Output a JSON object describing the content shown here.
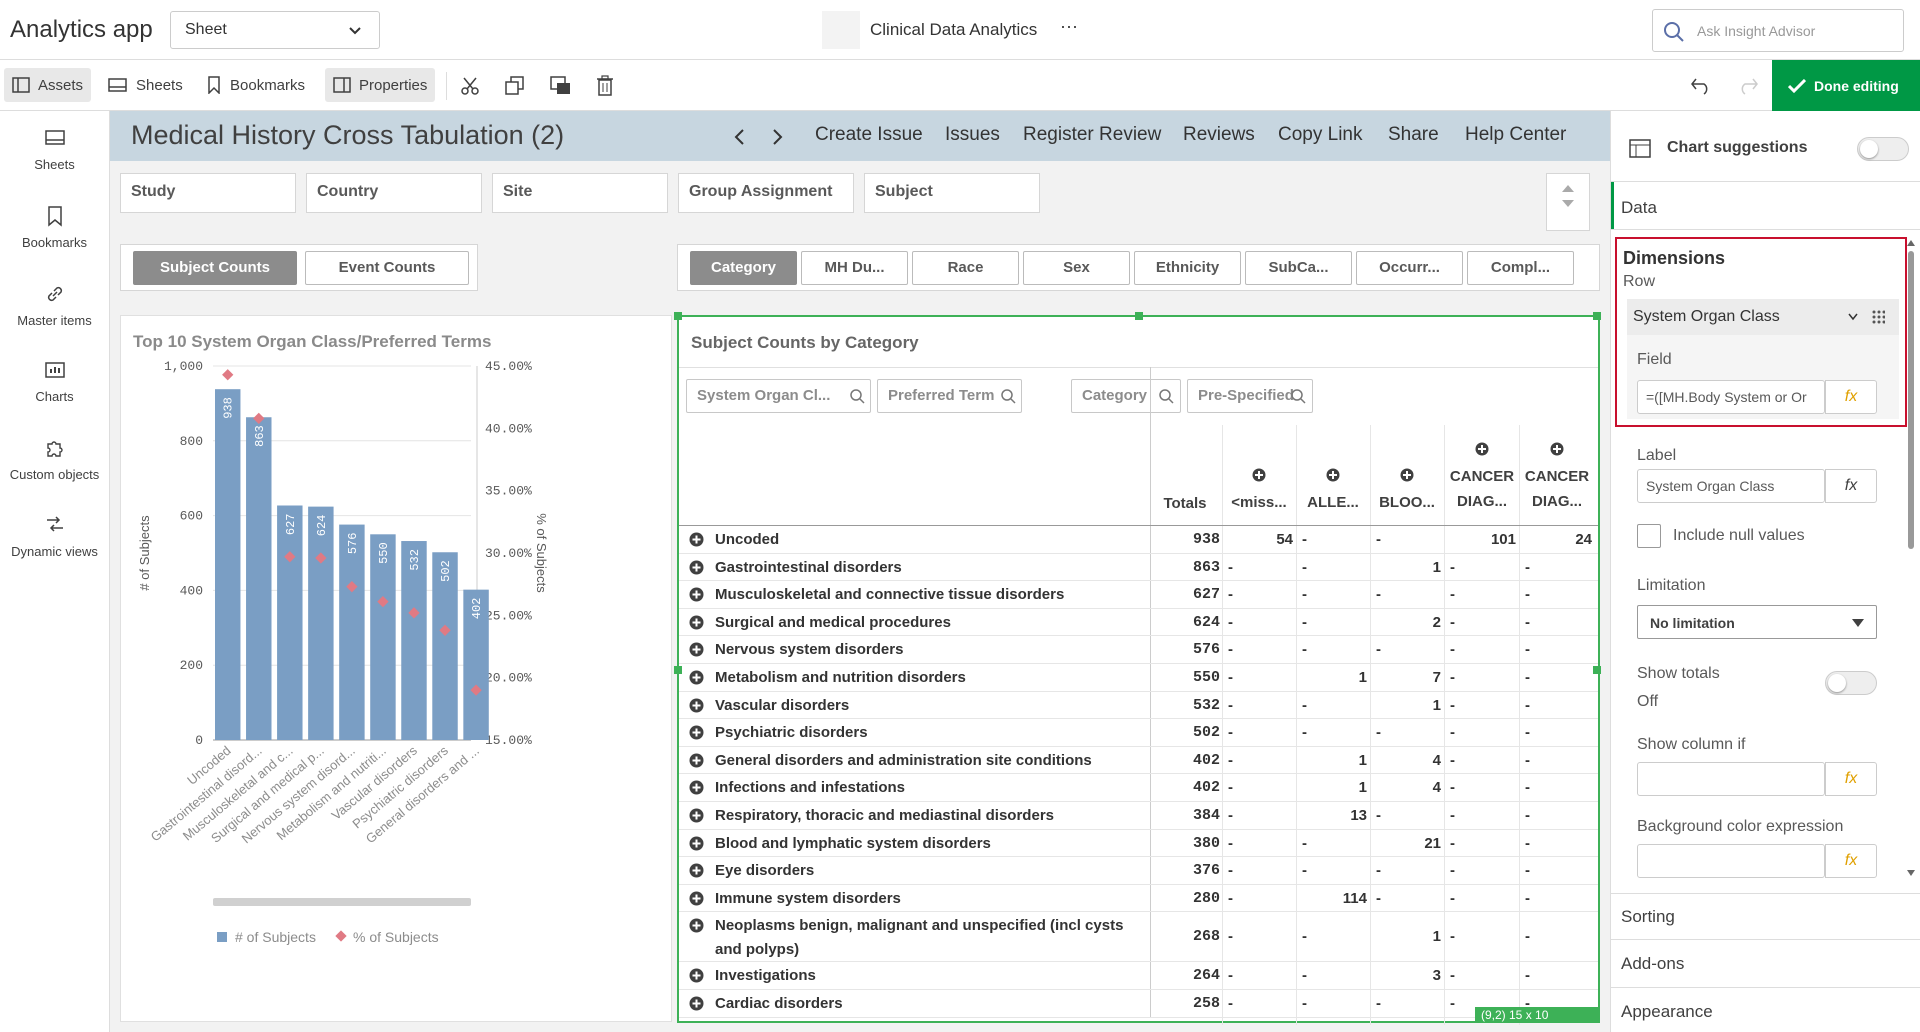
{
  "app": {
    "title": "Analytics app",
    "sheet_select": "Sheet",
    "center_title": "Clinical Data Analytics",
    "more": "···",
    "search_placeholder": "Ask Insight Advisor"
  },
  "toolbar": {
    "assets": "Assets",
    "sheets": "Sheets",
    "bookmarks": "Bookmarks",
    "properties": "Properties",
    "done": "Done editing"
  },
  "leftnav": [
    "Sheets",
    "Bookmarks",
    "Master items",
    "Charts",
    "Custom objects",
    "Dynamic views"
  ],
  "header": {
    "title": "Medical History Cross Tabulation (2)",
    "links": [
      "Create Issue",
      "Issues",
      "Register Review",
      "Reviews",
      "Copy Link",
      "Share",
      "Help Center"
    ]
  },
  "filters": [
    "Study",
    "Country",
    "Site",
    "Group Assignment",
    "Subject"
  ],
  "count_buttons": [
    "Subject Counts",
    "Event Counts"
  ],
  "category_buttons": [
    "Category",
    "MH Du...",
    "Race",
    "Sex",
    "Ethnicity",
    "SubCa...",
    "Occurr...",
    "Compl..."
  ],
  "chart_data": {
    "type": "bar",
    "title": "Top 10 System Organ Class/Preferred Terms",
    "categories": [
      "Uncoded",
      "Gastrointestinal disord...",
      "Musculoskeletal and c...",
      "Surgical and medical p...",
      "Nervous system disord...",
      "Metabolism and nutriti...",
      "Vascular disorders",
      "Psychiatric disorders",
      "General disorders and ..."
    ],
    "series": [
      {
        "name": "# of Subjects",
        "values": [
          938,
          863,
          627,
          624,
          576,
          550,
          532,
          502,
          402
        ],
        "color": "#7a9ec4"
      },
      {
        "name": "% of Subjects",
        "values": [
          44.3,
          40.8,
          29.7,
          29.6,
          27.3,
          26.1,
          25.2,
          23.8,
          19.0
        ],
        "color": "#e07a84"
      }
    ],
    "ylabel": "# of Subjects",
    "y2label": "% of Subjects",
    "ylim": [
      0,
      1000
    ],
    "y2lim": [
      15,
      45
    ],
    "yticks": [
      "0",
      "200",
      "400",
      "600",
      "800",
      "1,000"
    ],
    "y2ticks": [
      "15.00%",
      "20.00%",
      "25.00%",
      "30.00%",
      "35.00%",
      "40.00%",
      "45.00%"
    ],
    "legend": [
      "# of Subjects",
      "% of Subjects"
    ]
  },
  "table": {
    "title": "Subject Counts by Category",
    "search_left": [
      "System Organ Cl...",
      "Preferred Term"
    ],
    "search_right": [
      "Category",
      "Pre-Specified"
    ],
    "columns": [
      "Totals",
      "<miss...",
      "ALLE...",
      "BLOO...",
      "CANCER DIAG...",
      "CANCER DIAG..."
    ],
    "rows": [
      {
        "name": "Uncoded",
        "total": "938",
        "c1": "54",
        "c2": "-",
        "c3": "-",
        "c4": "101",
        "c5": "24"
      },
      {
        "name": "Gastrointestinal disorders",
        "total": "863",
        "c1": "-",
        "c2": "-",
        "c3": "1",
        "c4": "-",
        "c5": "-"
      },
      {
        "name": "Musculoskeletal and connective tissue disorders",
        "total": "627",
        "c1": "-",
        "c2": "-",
        "c3": "-",
        "c4": "-",
        "c5": "-"
      },
      {
        "name": "Surgical and medical procedures",
        "total": "624",
        "c1": "-",
        "c2": "-",
        "c3": "2",
        "c4": "-",
        "c5": "-"
      },
      {
        "name": "Nervous system disorders",
        "total": "576",
        "c1": "-",
        "c2": "-",
        "c3": "-",
        "c4": "-",
        "c5": "-"
      },
      {
        "name": "Metabolism and nutrition disorders",
        "total": "550",
        "c1": "-",
        "c2": "1",
        "c3": "7",
        "c4": "-",
        "c5": "-"
      },
      {
        "name": "Vascular disorders",
        "total": "532",
        "c1": "-",
        "c2": "-",
        "c3": "1",
        "c4": "-",
        "c5": "-"
      },
      {
        "name": "Psychiatric disorders",
        "total": "502",
        "c1": "-",
        "c2": "-",
        "c3": "-",
        "c4": "-",
        "c5": "-"
      },
      {
        "name": "General disorders and administration site conditions",
        "total": "402",
        "c1": "-",
        "c2": "1",
        "c3": "4",
        "c4": "-",
        "c5": "-"
      },
      {
        "name": "Infections and infestations",
        "total": "402",
        "c1": "-",
        "c2": "1",
        "c3": "4",
        "c4": "-",
        "c5": "-"
      },
      {
        "name": "Respiratory, thoracic and mediastinal disorders",
        "total": "384",
        "c1": "-",
        "c2": "13",
        "c3": "-",
        "c4": "-",
        "c5": "-"
      },
      {
        "name": "Blood and lymphatic system disorders",
        "total": "380",
        "c1": "-",
        "c2": "-",
        "c3": "21",
        "c4": "-",
        "c5": "-"
      },
      {
        "name": "Eye disorders",
        "total": "376",
        "c1": "-",
        "c2": "-",
        "c3": "-",
        "c4": "-",
        "c5": "-"
      },
      {
        "name": "Immune system disorders",
        "total": "280",
        "c1": "-",
        "c2": "114",
        "c3": "-",
        "c4": "-",
        "c5": "-"
      },
      {
        "name": "Neoplasms benign, malignant and unspecified (incl cysts and polyps)",
        "total": "268",
        "c1": "-",
        "c2": "-",
        "c3": "1",
        "c4": "-",
        "c5": "-"
      },
      {
        "name": "Investigations",
        "total": "264",
        "c1": "-",
        "c2": "-",
        "c3": "3",
        "c4": "-",
        "c5": "-"
      },
      {
        "name": "Cardiac disorders",
        "total": "258",
        "c1": "-",
        "c2": "-",
        "c3": "-",
        "c4": "-",
        "c5": "-"
      }
    ],
    "status": "(9,2)  15 x 10"
  },
  "props": {
    "chart_suggestions": "Chart suggestions",
    "data_tab": "Data",
    "dimensions": "Dimensions",
    "row": "Row",
    "dim_name": "System Organ Class",
    "field_label": "Field",
    "field_value": "=([MH.Body System or Or",
    "label_label": "Label",
    "label_value": "System Organ Class",
    "include_null": "Include null values",
    "limitation_label": "Limitation",
    "limitation_value": "No limitation",
    "show_totals": "Show totals",
    "show_totals_value": "Off",
    "show_column_if": "Show column if",
    "bg_color_expr": "Background color expression",
    "sorting": "Sorting",
    "addons": "Add-ons",
    "appearance": "Appearance",
    "fx": "fx"
  }
}
